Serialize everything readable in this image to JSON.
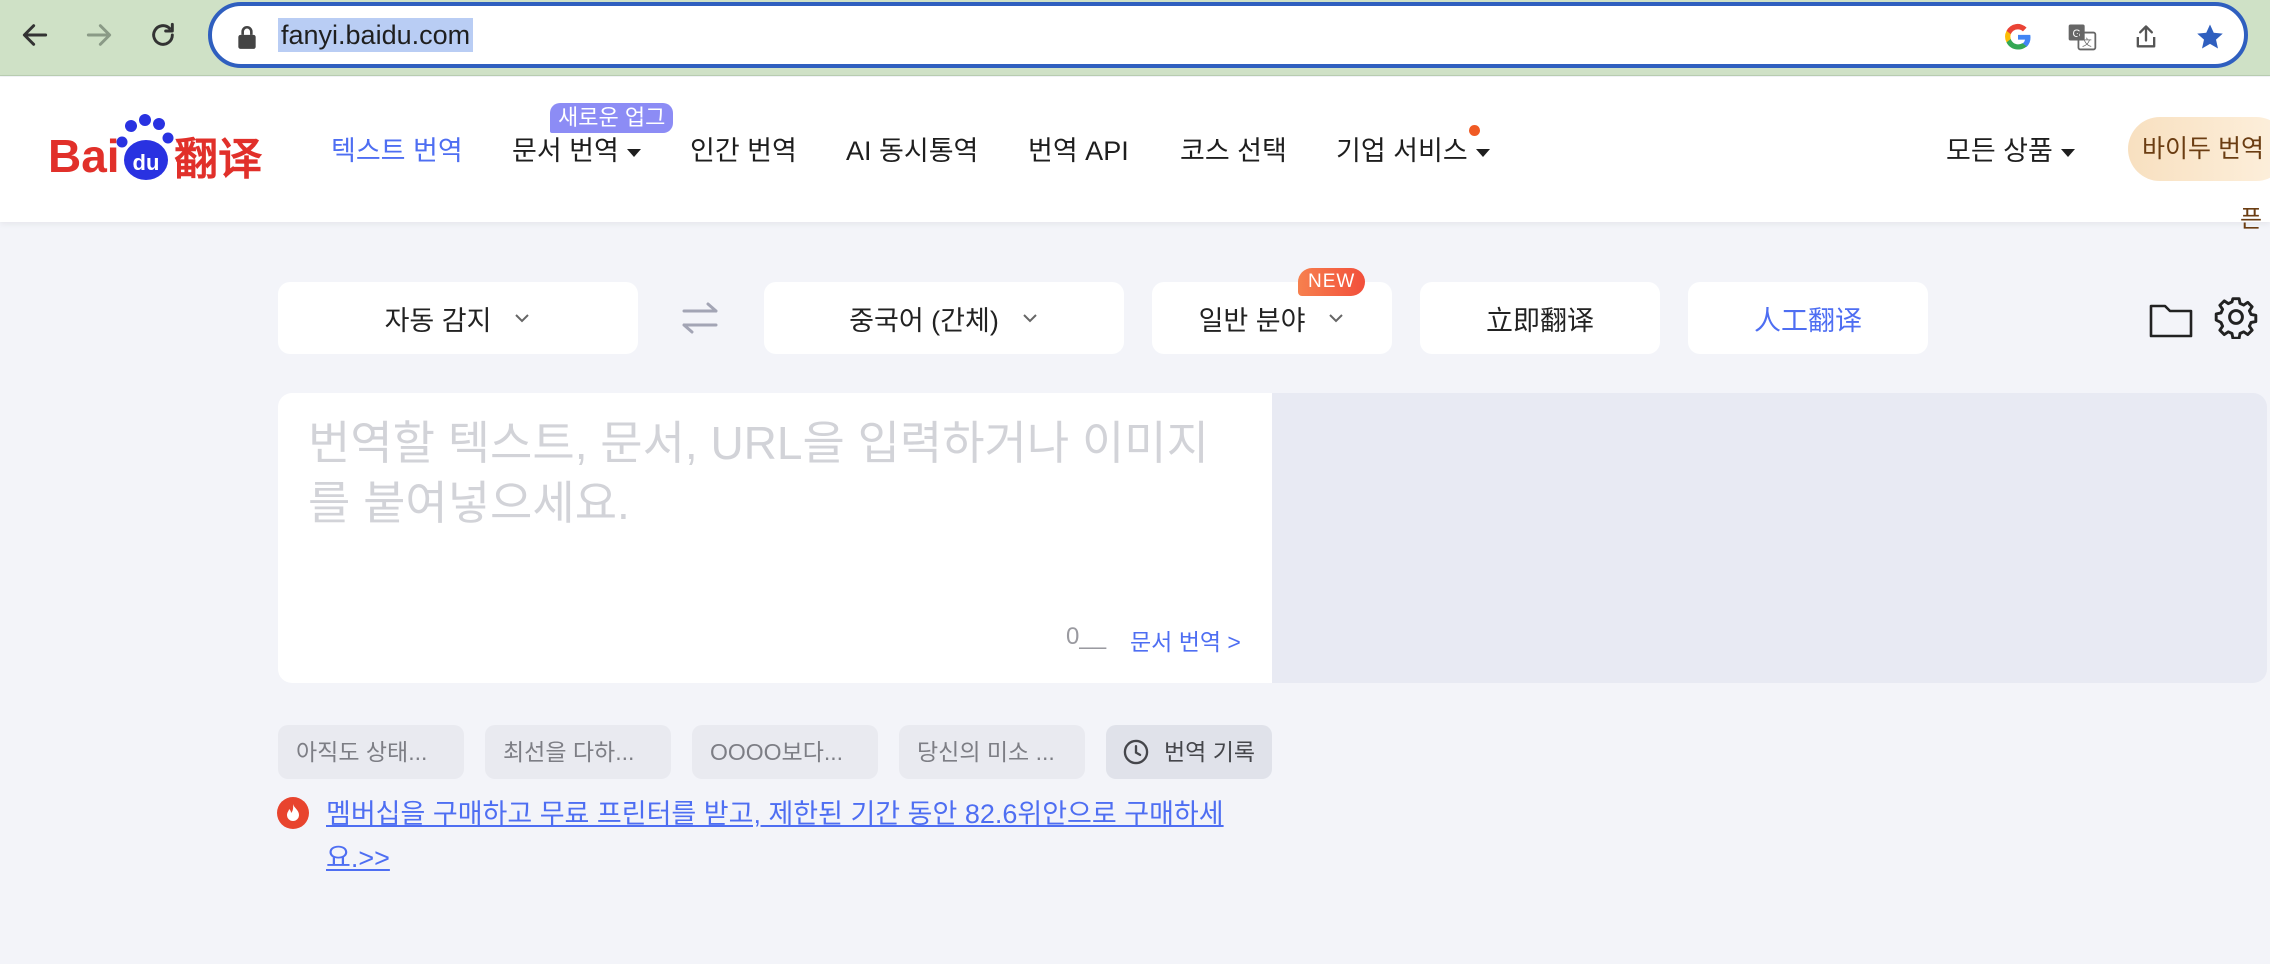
{
  "browser": {
    "url": "fanyi.baidu.com"
  },
  "header": {
    "nav": [
      {
        "label": "텍스트 번역",
        "active": true
      },
      {
        "label": "문서 번역",
        "dropdown": true
      },
      {
        "label": "인간 번역"
      },
      {
        "label": "AI 동시통역"
      },
      {
        "label": "번역 API"
      },
      {
        "label": "코스 선택"
      },
      {
        "label": "기업 서비스",
        "dropdown": true
      }
    ],
    "doc_badge": "새로운 업그",
    "all_products": "모든 상품",
    "baidu_button": "바이두 번역",
    "edge_text": "픈"
  },
  "toolbar": {
    "source_lang": "자동 감지",
    "target_lang": "중국어 (간체)",
    "domain": "일반 분야",
    "new_tag": "NEW",
    "instant_translate": "立即翻译",
    "human_translate": "人工翻译"
  },
  "source": {
    "placeholder": "번역할 텍스트, 문서, URL을 입력하거나 이미지를 붙여넣으세요.",
    "count": "0__",
    "doc_link": "문서 번역 >"
  },
  "history": {
    "items": [
      "아직도 상태...",
      "최선을 다하...",
      "OOOO보다...",
      "당신의 미소 ..."
    ],
    "history_label": "번역 기록"
  },
  "promo": {
    "text": "멤버십을 구매하고 무료 프린터를 받고, 제한된 기간 동안 82.6위안으로 구매하세요.>>"
  },
  "colors": {
    "accent": "#4e6ef2",
    "chrome": "#cfe1c6",
    "omnibox_border": "#2f5fbf"
  }
}
